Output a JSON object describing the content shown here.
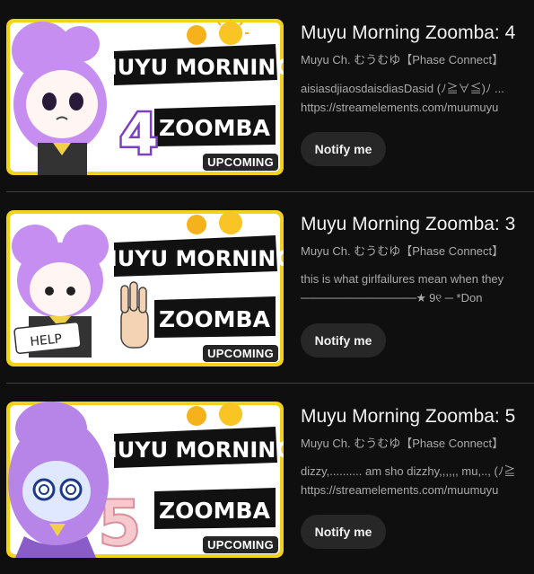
{
  "colors": {
    "background": "#0f0f0f",
    "button": "#272727",
    "thumb_border": "#f2d31b"
  },
  "videos": [
    {
      "title": "Muyu Morning Zoomba: 4",
      "channel": "Muyu Ch. むうむゆ【Phase Connect】",
      "desc_line1": "aisiasdjiaosdaisdiasDasid (ﾉ≧∀≦)ﾉ ...",
      "desc_line2": "https://streamelements.com/muumuyu",
      "notify_label": "Notify me",
      "badge": "UPCOMING",
      "banner_top": "MUYU MORNING",
      "banner_bottom": "ZOOMBA",
      "number": "4",
      "icon": "sun-icon"
    },
    {
      "title": "Muyu Morning Zoomba: 3",
      "channel": "Muyu Ch. むうむゆ【Phase Connect】",
      "desc_line1": "this is what girlfailures mean when they",
      "desc_line2": "──────────────★ 9୧ ─ *Don",
      "notify_label": "Notify me",
      "badge": "UPCOMING",
      "banner_top": "MUYU MORNING",
      "banner_bottom": "ZOOMBA",
      "sign": "HELP",
      "icon": "sun-icon"
    },
    {
      "title": "Muyu Morning Zoomba: 5",
      "channel": "Muyu Ch. むうむゆ【Phase Connect】",
      "desc_line1": "dizzy,.......... am sho dizzhy,,,,,, mu,.., (ﾉ≧",
      "desc_line2": "https://streamelements.com/muumuyu",
      "notify_label": "Notify me",
      "badge": "UPCOMING",
      "banner_top": "MUYU MORNING",
      "banner_bottom": "ZOOMBA",
      "number": "5",
      "icon": "sun-icon"
    }
  ]
}
